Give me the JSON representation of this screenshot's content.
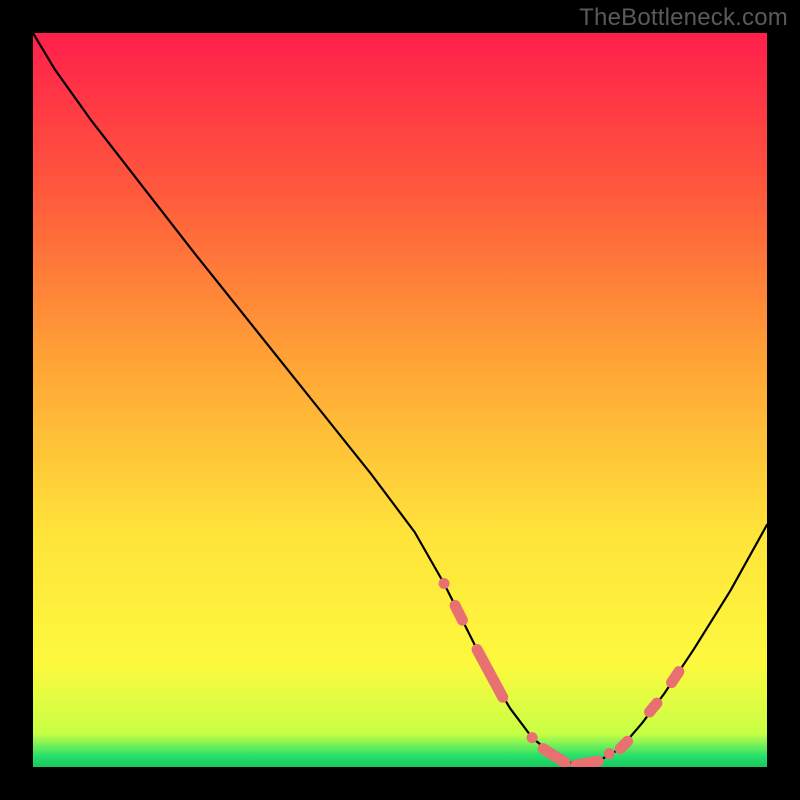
{
  "watermark": "TheBottleneck.com",
  "gradient": {
    "stops": [
      {
        "offset": 0.0,
        "color": "#ff1f4b"
      },
      {
        "offset": 0.22,
        "color": "#ff5a3c"
      },
      {
        "offset": 0.45,
        "color": "#ffa436"
      },
      {
        "offset": 0.68,
        "color": "#ffe33a"
      },
      {
        "offset": 0.86,
        "color": "#fdf93e"
      },
      {
        "offset": 0.955,
        "color": "#c7ff45"
      },
      {
        "offset": 0.985,
        "color": "#25e06a"
      },
      {
        "offset": 1.0,
        "color": "#19c95e"
      }
    ]
  },
  "chart_data": {
    "type": "line",
    "title": "",
    "xlabel": "",
    "ylabel": "",
    "xlim": [
      0,
      100
    ],
    "ylim": [
      0,
      100
    ],
    "x": [
      0,
      3,
      8,
      15,
      22,
      30,
      38,
      46,
      52,
      56,
      59,
      62,
      65,
      68,
      71,
      74,
      77,
      80,
      83,
      86,
      90,
      95,
      100
    ],
    "values": [
      100,
      95,
      88,
      79,
      70,
      60,
      50,
      40,
      32,
      25,
      19,
      13,
      8,
      4,
      1.5,
      0.3,
      0.8,
      2.5,
      6,
      10,
      16,
      24,
      33
    ],
    "markers_x": [
      56,
      57.5,
      58.5,
      60.5,
      61.2,
      62.2,
      63,
      64,
      68,
      69.5,
      70,
      71,
      71.5,
      72.5,
      74,
      75,
      76,
      77,
      78.5,
      80,
      81,
      84,
      85,
      87,
      88
    ],
    "markers_y": [
      25,
      22,
      20,
      16,
      14.5,
      12.5,
      11,
      9.5,
      4,
      2.5,
      1.8,
      1.3,
      1,
      0.6,
      0.3,
      0.4,
      0.7,
      0.8,
      1.8,
      2.5,
      3.5,
      7.5,
      8.7,
      11.5,
      13
    ]
  }
}
